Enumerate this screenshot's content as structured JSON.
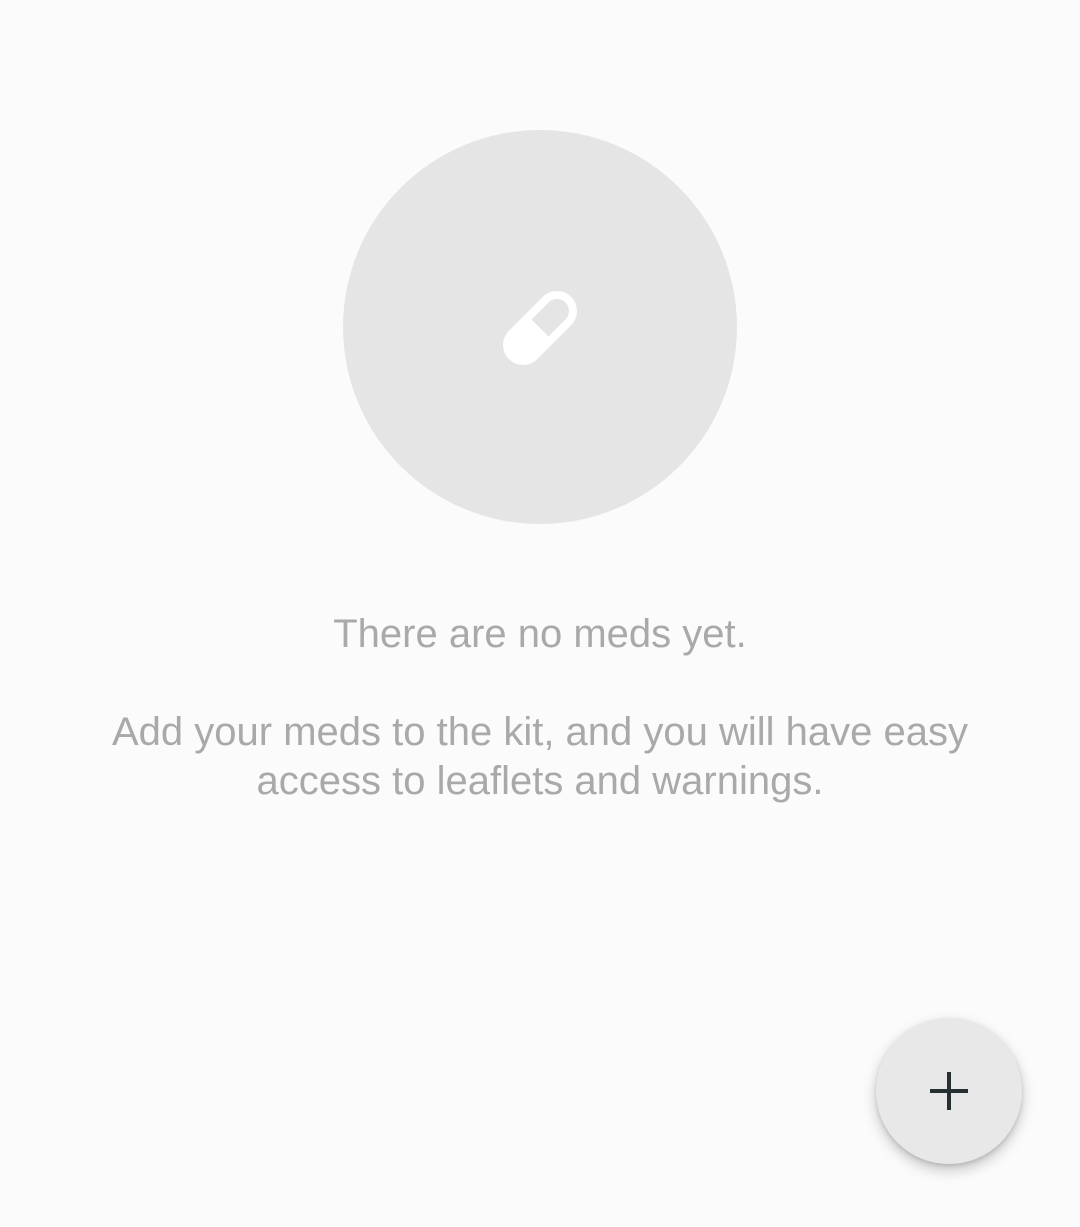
{
  "empty_state": {
    "illustration_icon": "pill-icon",
    "title": "There are no meds yet.",
    "description": "Add your meds to the kit, and you will have easy access to leaflets and warnings."
  },
  "fab": {
    "icon": "plus-icon"
  },
  "colors": {
    "background": "#fbfbfb",
    "circle": "#e5e5e5",
    "text": "#a9a9a9",
    "fab_background": "#e8e8e8",
    "fab_icon": "#263033"
  }
}
